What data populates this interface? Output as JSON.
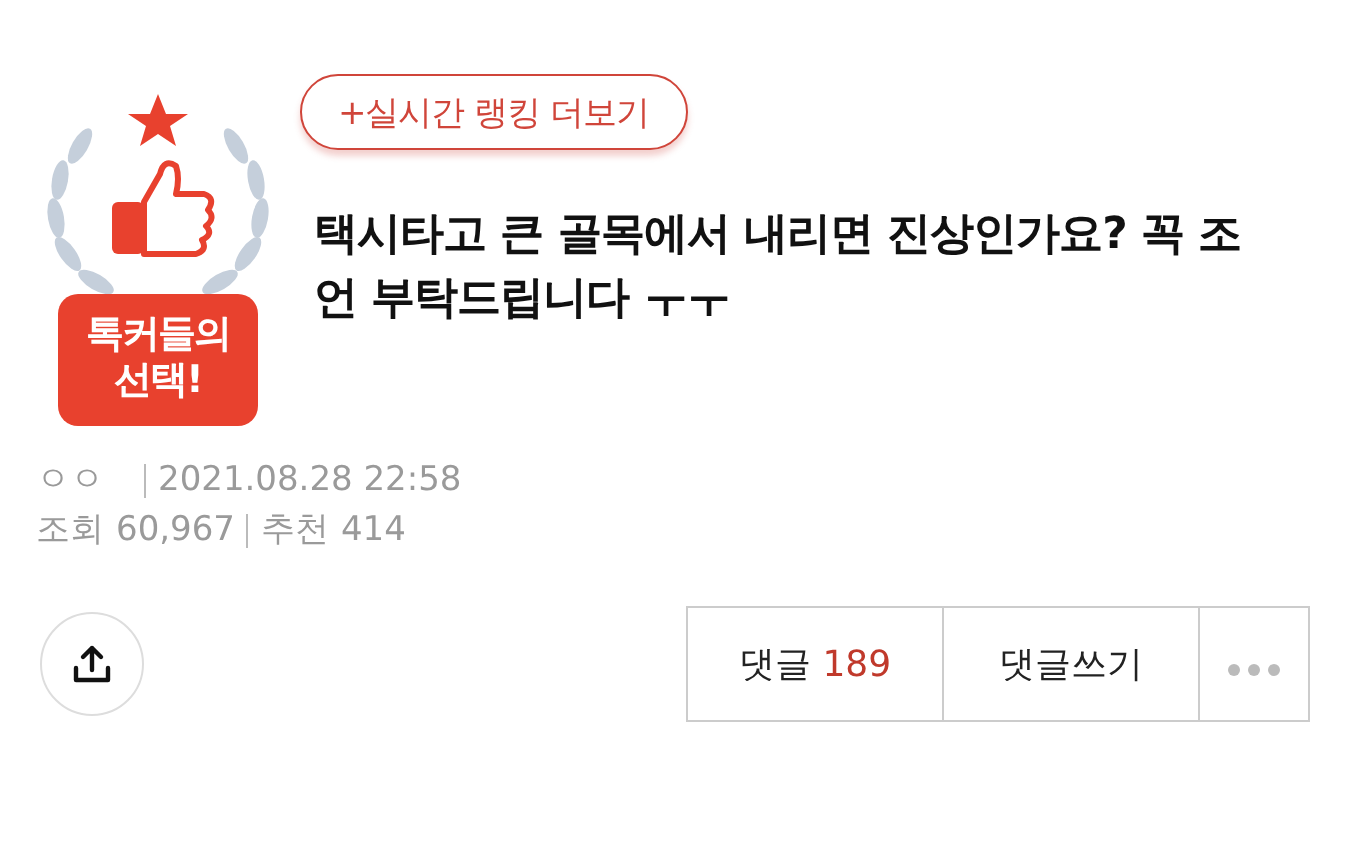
{
  "ranking_button": {
    "label": "+실시간 랭킹 더보기"
  },
  "badge": {
    "label": "톡커들의 선택!"
  },
  "post": {
    "title": "택시타고 큰 골목에서 내리면 진상인가요? 꼭 조언 부탁드립니다 ㅜㅜ",
    "author": "ㅇㅇ",
    "date": "2021.08.28 22:58",
    "views_label": "조회",
    "views": "60,967",
    "likes_label": "추천",
    "likes": "414"
  },
  "actions": {
    "comments_label": "댓글",
    "comments_count": "189",
    "write_label": "댓글쓰기"
  }
}
